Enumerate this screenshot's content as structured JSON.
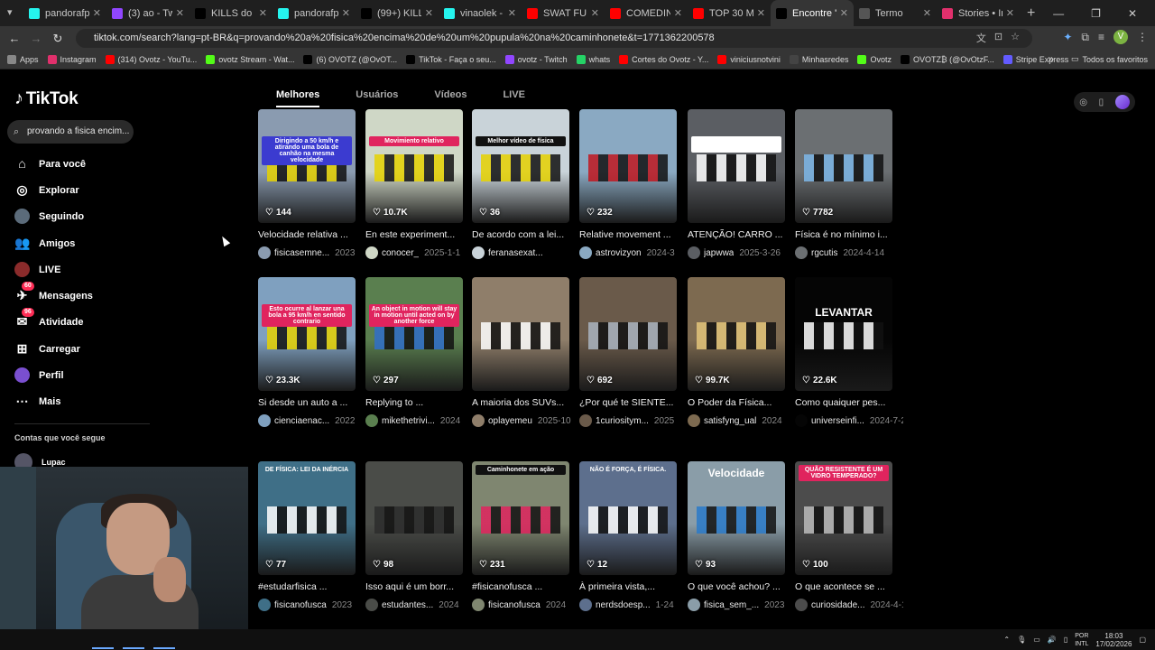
{
  "browser": {
    "tabs": [
      {
        "title": "pandorafps",
        "color": "#25f4ee"
      },
      {
        "title": "(3) ao - Twitch",
        "color": "#9146ff"
      },
      {
        "title": "KILLS do Rafa",
        "color": "#000000"
      },
      {
        "title": "pandorafps",
        "color": "#25f4ee"
      },
      {
        "title": "(99+) KILLS d",
        "color": "#000000"
      },
      {
        "title": "vinaolek - W",
        "color": "#25f4ee"
      },
      {
        "title": "SWAT FURO",
        "color": "#ff0000"
      },
      {
        "title": "COMEDINHA",
        "color": "#ff0000"
      },
      {
        "title": "TOP 30 Mom",
        "color": "#ff0000"
      },
      {
        "title": "Encontre 'p",
        "color": "#000000",
        "active": true
      },
      {
        "title": "Termo",
        "color": "#555555"
      },
      {
        "title": "Stories • Inst",
        "color": "#e1306c"
      }
    ],
    "new_tab": "+",
    "url": "tiktok.com/search?lang=pt-BR&q=provando%20a%20fisica%20encima%20de%20um%20pupula%20na%20caminhonete&t=1771362200578",
    "profile_initial": "V"
  },
  "bookmarks": [
    {
      "label": "Apps",
      "color": "#888888"
    },
    {
      "label": "Instagram",
      "color": "#e1306c"
    },
    {
      "label": "(314) Ovotz - YouTu...",
      "color": "#ff0000"
    },
    {
      "label": "ovotz Stream - Wat...",
      "color": "#53fc18"
    },
    {
      "label": "(6) OVOTZ (@OvOT...",
      "color": "#000000"
    },
    {
      "label": "TikTok - Faça o seu...",
      "color": "#000000"
    },
    {
      "label": "ovotz - Twitch",
      "color": "#9146ff"
    },
    {
      "label": "whats",
      "color": "#25d366"
    },
    {
      "label": "Cortes do Ovotz - Y...",
      "color": "#ff0000"
    },
    {
      "label": "viniciusnotvini",
      "color": "#ff0000"
    },
    {
      "label": "Minhasredes",
      "color": "#444444"
    },
    {
      "label": "Ovotz",
      "color": "#53fc18"
    },
    {
      "label": "OVOTZ₿ (@OvOtzF...",
      "color": "#000000"
    },
    {
      "label": "Stripe Express",
      "color": "#635bff"
    }
  ],
  "bookmarks_more": "»",
  "bookmarks_all": "Todos os favoritos",
  "tiktok": {
    "logo": "TikTok",
    "search_value": "provando a fisica encim...",
    "nav": [
      {
        "label": "Para você",
        "icon": "home-icon",
        "glyph": "⌂"
      },
      {
        "label": "Explorar",
        "icon": "compass-icon",
        "glyph": "◎"
      },
      {
        "label": "Seguindo",
        "icon": "following-avatar-icon",
        "glyph": ""
      },
      {
        "label": "Amigos",
        "icon": "friends-icon",
        "glyph": "👥"
      },
      {
        "label": "LIVE",
        "icon": "live-icon",
        "glyph": ""
      },
      {
        "label": "Mensagens",
        "icon": "messages-icon",
        "glyph": "✈",
        "badge": "60"
      },
      {
        "label": "Atividade",
        "icon": "activity-icon",
        "glyph": "✉",
        "badge": "96"
      },
      {
        "label": "Carregar",
        "icon": "upload-icon",
        "glyph": "⊞"
      },
      {
        "label": "Perfil",
        "icon": "profile-icon",
        "glyph": ""
      },
      {
        "label": "Mais",
        "icon": "more-icon",
        "glyph": "⋯"
      }
    ],
    "following_heading": "Contas que você segue",
    "following_user": "Lupac",
    "search_tabs": [
      "Melhores",
      "Usuários",
      "Vídeos",
      "LIVE"
    ],
    "active_tab": "Melhores",
    "videos": [
      {
        "likes": "144",
        "desc": "Velocidade relativa ...",
        "user": "fisicasemne...",
        "date": "2023",
        "thumb": "#8a9bb0",
        "accent": "#e6d200",
        "overlay": "Dirigindo a 50 km/h e atirando uma bola de canhão na mesma velocidade",
        "overlay_color": "#3b3bd0"
      },
      {
        "likes": "10.7K",
        "desc": "En este experiment...",
        "user": "conocer_",
        "date": "2025-1-1",
        "thumb": "#cfd7c6",
        "accent": "#e6d200",
        "overlay": "Movimiento relativo",
        "overlay_color": "#e0245e"
      },
      {
        "likes": "36",
        "desc": "De acordo com a lei...",
        "user": "feranasexat...",
        "date": "",
        "thumb": "#c9d3d9",
        "accent": "#e6d200",
        "overlay": "Melhor vídeo de física",
        "overlay_color": "#111111"
      },
      {
        "likes": "232",
        "desc": "Relative movement ...",
        "user": "astrovizyon",
        "date": "2024-3",
        "thumb": "#8aa9c2",
        "accent": "#c0171f",
        "overlay": "",
        "overlay_color": ""
      },
      {
        "likes": "",
        "desc": "ATENÇÃO! CARRO ...",
        "user": "japwwa",
        "date": "2025-3-26",
        "thumb": "#5b5e63",
        "accent": "#ffffff",
        "overlay": "um carro bate num pulo, onde você cai?",
        "overlay_color": "#ffffff"
      },
      {
        "likes": "7782",
        "desc": "Física é no mínimo i...",
        "user": "rgcutis",
        "date": "2024-4-14",
        "thumb": "#6b6f72",
        "accent": "#7db7e8",
        "overlay": "",
        "overlay_color": ""
      },
      {
        "likes": "23.3K",
        "desc": "Si desde un auto a ...",
        "user": "cienciaenac...",
        "date": "2022",
        "thumb": "#7fa0bf",
        "accent": "#e6d200",
        "overlay": "Esto ocurre al lanzar una bola a 95 km/h en sentido contrario",
        "overlay_color": "#e0245e"
      },
      {
        "likes": "297",
        "desc": "Replying to ...",
        "user": "mikethetrivi...",
        "date": "2024",
        "thumb": "#5a7f4f",
        "accent": "#2f6ec9",
        "overlay": "An object in motion will stay in motion until acted on by another force",
        "overlay_color": "#e0245e"
      },
      {
        "likes": "",
        "desc": "A maioria dos SUVs...",
        "user": "oplayemeu",
        "date": "2025-10",
        "thumb": "#8f7e6a",
        "accent": "#ffffff",
        "overlay": "",
        "overlay_color": ""
      },
      {
        "likes": "692",
        "desc": "¿Por qué te SIENTE...",
        "user": "1curiositym...",
        "date": "2025",
        "thumb": "#6a5a4a",
        "accent": "#aab4c0",
        "overlay": "",
        "overlay_color": ""
      },
      {
        "likes": "99.7K",
        "desc": "O Poder da Física...",
        "user": "satisfyng_ual",
        "date": "2024",
        "thumb": "#7d6a50",
        "accent": "#e3c57a",
        "overlay": "",
        "overlay_color": ""
      },
      {
        "likes": "22.6K",
        "desc": "Como quaiquer pes...",
        "user": "universeinfi...",
        "date": "2024-7-2",
        "thumb": "#050505",
        "accent": "#ffffff",
        "overlay": "LEVANTAR",
        "overlay_color": ""
      },
      {
        "likes": "77",
        "desc": "#estudarfisica ...",
        "user": "fisicanofusca",
        "date": "2023",
        "thumb": "#3f6f87",
        "accent": "#ffffff",
        "overlay": "DE FÍSICA: LEI DA INÉRCIA",
        "overlay_color": ""
      },
      {
        "likes": "98",
        "desc": "Isso aqui é um borr...",
        "user": "estudantes...",
        "date": "2024",
        "thumb": "#4a4c48",
        "accent": "#2c2c2c",
        "overlay": "",
        "overlay_color": ""
      },
      {
        "likes": "231",
        "desc": "#fisicanofusca ...",
        "user": "fisicanofusca",
        "date": "2024",
        "thumb": "#7f8670",
        "accent": "#e0245e",
        "overlay": "Caminhonete em ação",
        "overlay_color": "#111111"
      },
      {
        "likes": "12",
        "desc": "À primeira vista,...",
        "user": "nerdsdoesp...",
        "date": "1-24",
        "thumb": "#5d6f8d",
        "accent": "#ffffff",
        "overlay": "NÃO É FORÇA, É FÍSICA.",
        "overlay_color": ""
      },
      {
        "likes": "93",
        "desc": "O que você achou? ...",
        "user": "fisica_sem_...",
        "date": "2023",
        "thumb": "#8a9da8",
        "accent": "#2a7ac9",
        "overlay": "Velocidade",
        "overlay_color": ""
      },
      {
        "likes": "100",
        "desc": "O que acontece se ...",
        "user": "curiosidade...",
        "date": "2024-4-14",
        "thumb": "#4c4c4c",
        "accent": "#bbbbbb",
        "overlay": "QUÃO RESISTENTE É UM VIDRO TEMPERADO?",
        "overlay_color": "#e0245e"
      }
    ]
  },
  "taskbar": {
    "lang1": "POR",
    "lang2": "INTL",
    "time": "18:03",
    "date": "17/02/2026"
  }
}
